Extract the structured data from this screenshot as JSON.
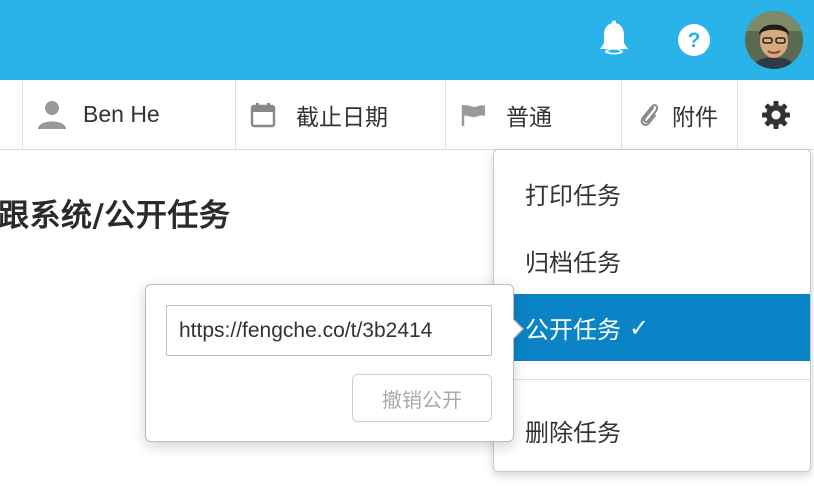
{
  "colors": {
    "topbar": "#2ab3e9",
    "menu_active": "#0a84c6"
  },
  "header": {
    "icons": [
      "bell-icon",
      "help-icon",
      "avatar"
    ]
  },
  "toolbar": {
    "assignee_label": "Ben He",
    "due_label": "截止日期",
    "priority_label": "普通",
    "attachment_label": "附件",
    "icons": [
      "user-icon",
      "calendar-icon",
      "flag-icon",
      "paperclip-icon",
      "gear-icon"
    ]
  },
  "task": {
    "title": "跟系统/公开任务"
  },
  "menu": {
    "items": [
      {
        "label": "打印任务"
      },
      {
        "label": "归档任务"
      },
      {
        "label": "公开任务",
        "check": "✓",
        "active": true
      },
      {
        "label": "删除任务"
      }
    ]
  },
  "publish_popover": {
    "url": "https://fengche.co/t/3b2414",
    "revoke_label": "撤销公开"
  }
}
